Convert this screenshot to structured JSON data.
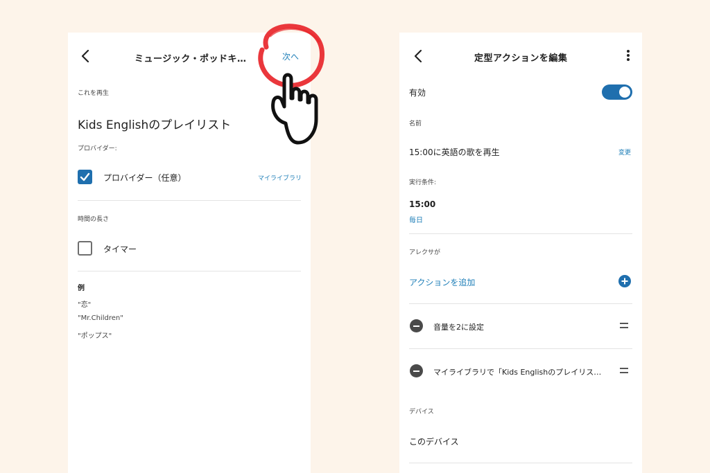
{
  "left_screen": {
    "header": {
      "title": "ミュージック・ポッドキ…",
      "next_label": "次へ"
    },
    "play_section": {
      "label": "これを再生",
      "item": "Kids Englishのプレイリスト"
    },
    "provider_section": {
      "label": "プロバイダー:",
      "checkbox_label": "プロバイダー（任意）",
      "link": "マイライブラリ"
    },
    "duration_section": {
      "label": "時間の長さ",
      "checkbox_label": "タイマー"
    },
    "examples": {
      "label": "例",
      "items": [
        "\"恋\"",
        "\"Mr.Children\"",
        "\"ポップス\""
      ]
    }
  },
  "right_screen": {
    "header": {
      "title": "定型アクションを編集"
    },
    "enabled": {
      "label": "有効"
    },
    "name_section": {
      "label": "名前",
      "value": "15:00に英語の歌を再生",
      "change_link": "変更"
    },
    "trigger_section": {
      "label": "実行条件:",
      "time": "15:00",
      "repeat": "毎日"
    },
    "alexa_section": {
      "label": "アレクサが",
      "add_action": "アクションを追加",
      "actions": [
        {
          "label": "音量を2に設定"
        },
        {
          "label": "マイライブラリで「Kids Englishのプレイリス…"
        }
      ]
    },
    "device_section": {
      "label": "デバイス",
      "value": "このデバイス"
    }
  },
  "colors": {
    "accent": "#1f6fae",
    "link": "#1f7fb8",
    "annotation_red": "#e8262b",
    "background": "#fdf4ea"
  }
}
